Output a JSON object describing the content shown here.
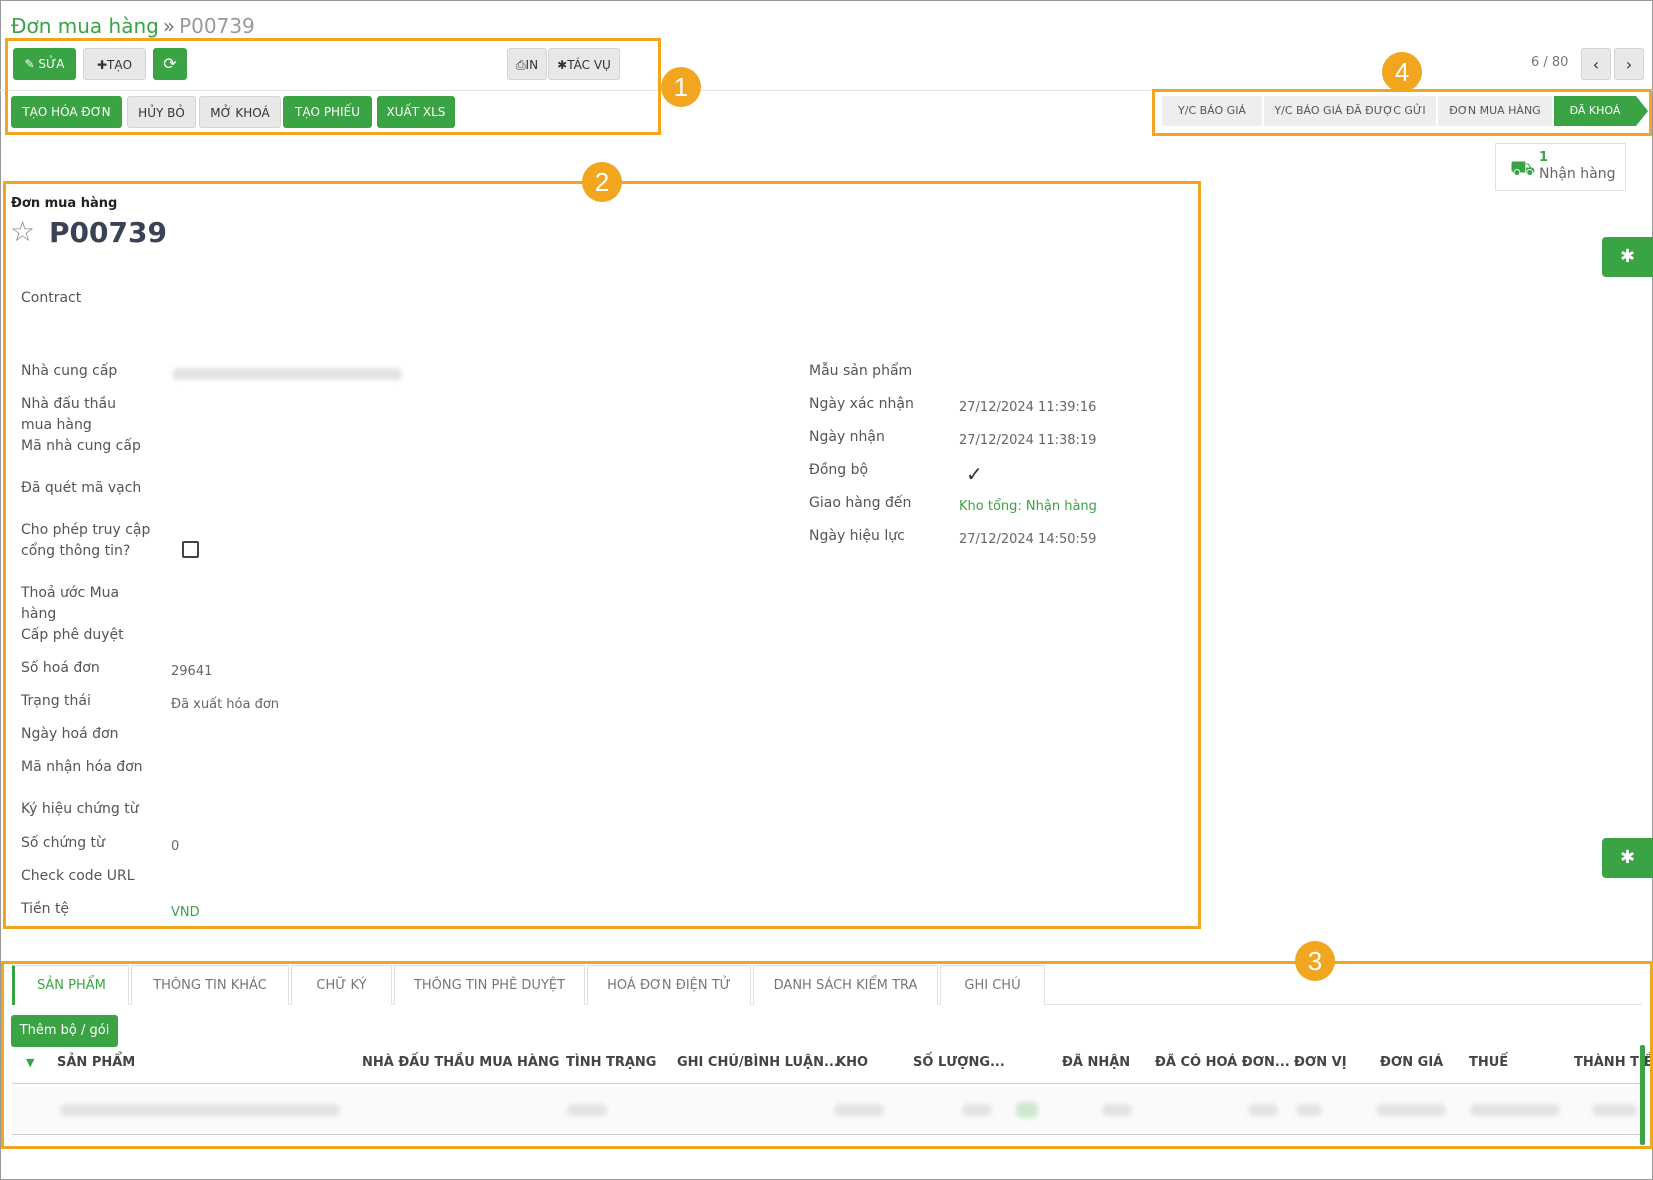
{
  "breadcrumb": {
    "parent": "Đơn mua hàng",
    "separator": "»",
    "current": "P00739"
  },
  "toolbar": {
    "edit": "SỬA",
    "create": "TẠO",
    "print": "IN",
    "actions": "TÁC VỤ"
  },
  "actions_row": {
    "create_invoice": "TẠO HÓA ĐƠN",
    "cancel": "HỦY BỎ",
    "unlock": "MỞ KHOÁ",
    "create_picking": "TẠO PHIẾU",
    "export_xls": "XUẤT XLS"
  },
  "pager": {
    "text": "6 / 80"
  },
  "stages": [
    "Y/C BÁO GIÁ",
    "Y/C BÁO GIÁ ĐÃ ĐƯỢC GỬI",
    "ĐƠN MUA HÀNG",
    "ĐÃ KHOÁ"
  ],
  "smart_button": {
    "count": "1",
    "label": "Nhận hàng"
  },
  "annotations": [
    "1",
    "2",
    "3",
    "4"
  ],
  "form": {
    "caption": "Đơn mua hàng",
    "title": "P00739",
    "contract": "Contract",
    "left_labels": {
      "supplier": "Nhà cung cấp",
      "purchase_bidder": "Nhà đấu thầu mua hàng",
      "supplier_code": "Mã nhà cung cấp",
      "barcode_scanned": "Đã quét mã vạch",
      "portal_access": "Cho phép truy cập cổng thông tin?",
      "purchase_agreement": "Thoả ước Mua hàng",
      "approval_level": "Cấp phê duyệt",
      "invoice_number": "Số hoá đơn",
      "status": "Trạng thái",
      "invoice_date": "Ngày hoá đơn",
      "invoice_receive_code": "Mã nhận hóa đơn",
      "voucher_symbol": "Ký hiệu chứng từ",
      "voucher_number": "Số chứng từ",
      "check_code_url": "Check code URL",
      "currency": "Tiền tệ"
    },
    "left_values": {
      "invoice_number": "29641",
      "status": "Đã xuất hóa đơn",
      "voucher_number": "0",
      "currency": "VND"
    },
    "right_labels": {
      "product_template": "Mẫu sản phẩm",
      "confirm_date": "Ngày xác nhận",
      "receive_date": "Ngày nhận",
      "sync": "Đồng bộ",
      "deliver_to": "Giao hàng đến",
      "effective_date": "Ngày hiệu lực"
    },
    "right_values": {
      "confirm_date": "27/12/2024 11:39:16",
      "receive_date": "27/12/2024 11:38:19",
      "deliver_to": "Kho tổng: Nhận hàng",
      "effective_date": "27/12/2024 14:50:59"
    }
  },
  "tabs": [
    "SẢN PHẨM",
    "THÔNG TIN KHÁC",
    "CHỮ KÝ",
    "THÔNG TIN PHÊ DUYỆT",
    "HOÁ ĐƠN ĐIỆN TỬ",
    "DANH SÁCH KIỂM TRA",
    "GHI CHÚ"
  ],
  "add_bundle": "Thêm bộ / gói",
  "table_headers": [
    "SẢN PHẨM",
    "NHÀ ĐẤU THẦU MUA HÀNG",
    "TÌNH TRẠNG",
    "GHI CHÚ/BÌNH LUẬN...",
    "KHO",
    "SỐ LƯỢNG...",
    "ĐÃ NHẬN",
    "ĐÃ CÓ HOÁ ĐƠN...",
    "ĐƠN VỊ",
    "ĐƠN GIÁ",
    "THUẾ",
    "THÀNH TIỀ"
  ],
  "colors": {
    "accent": "#3aa344",
    "highlight": "#f2a61f"
  }
}
